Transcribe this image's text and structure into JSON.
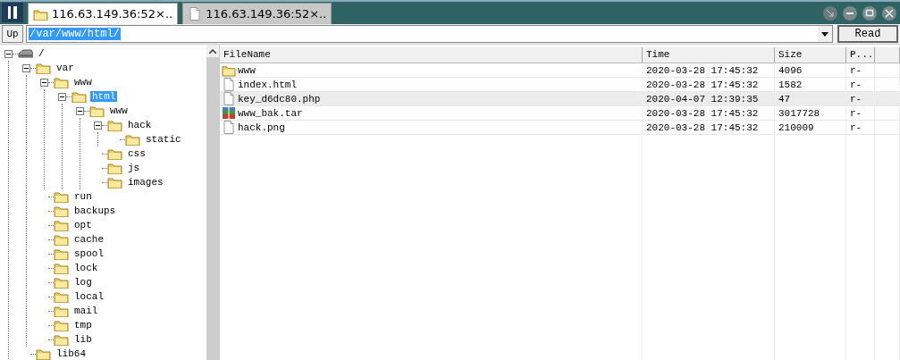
{
  "tabs": [
    {
      "label": "116.63.149.36:52×..",
      "kind": "folder",
      "selected": true
    },
    {
      "label": "116.63.149.36:52×..",
      "kind": "file",
      "selected": false
    }
  ],
  "address": {
    "button": "Up",
    "value": "/var/www/html/",
    "action": "Read"
  },
  "tree": [
    {
      "label": "/",
      "kind": "drive",
      "expanded": true,
      "selected": false,
      "children": [
        {
          "label": "var",
          "kind": "folder",
          "expanded": true,
          "selected": false,
          "children": [
            {
              "label": "www",
              "kind": "folder",
              "expanded": true,
              "selected": false,
              "children": [
                {
                  "label": "html",
                  "kind": "folder",
                  "expanded": true,
                  "selected": true,
                  "children": [
                    {
                      "label": "www",
                      "kind": "folder",
                      "expanded": true,
                      "selected": false,
                      "children": [
                        {
                          "label": "hack",
                          "kind": "folder",
                          "expanded": true,
                          "selected": false,
                          "children": [
                            {
                              "label": "static",
                              "kind": "folder",
                              "selected": false
                            }
                          ]
                        },
                        {
                          "label": "css",
                          "kind": "folder",
                          "selected": false
                        },
                        {
                          "label": "js",
                          "kind": "folder",
                          "selected": false
                        },
                        {
                          "label": "images",
                          "kind": "folder",
                          "selected": false
                        }
                      ]
                    }
                  ]
                }
              ]
            },
            {
              "label": "run",
              "kind": "folder",
              "selected": false
            },
            {
              "label": "backups",
              "kind": "folder",
              "selected": false
            },
            {
              "label": "opt",
              "kind": "folder",
              "selected": false
            },
            {
              "label": "cache",
              "kind": "folder",
              "selected": false
            },
            {
              "label": "spool",
              "kind": "folder",
              "selected": false
            },
            {
              "label": "lock",
              "kind": "folder",
              "selected": false
            },
            {
              "label": "log",
              "kind": "folder",
              "selected": false
            },
            {
              "label": "local",
              "kind": "folder",
              "selected": false
            },
            {
              "label": "mail",
              "kind": "folder",
              "selected": false
            },
            {
              "label": "tmp",
              "kind": "folder",
              "selected": false
            },
            {
              "label": "lib",
              "kind": "folder",
              "selected": false
            }
          ]
        },
        {
          "label": "lib64",
          "kind": "folder",
          "selected": false
        }
      ]
    }
  ],
  "table": {
    "columns": [
      "FileName",
      "Time",
      "Size",
      "P..."
    ],
    "rows": [
      {
        "kind": "folder",
        "name": "www",
        "time": "2020-03-28 17:45:32",
        "size": "4096",
        "perm": "r-",
        "selected": false
      },
      {
        "kind": "file",
        "name": "index.html",
        "time": "2020-03-28 17:45:32",
        "size": "1582",
        "perm": "r-",
        "selected": false
      },
      {
        "kind": "file",
        "name": "key_d6dc80.php",
        "time": "2020-04-07 12:39:35",
        "size": "47",
        "perm": "r-",
        "selected": true
      },
      {
        "kind": "archive",
        "name": "www_bak.tar",
        "time": "2020-03-28 17:45:32",
        "size": "3017728",
        "perm": "r-",
        "selected": false
      },
      {
        "kind": "file",
        "name": "hack.png",
        "time": "2020-03-28 17:45:32",
        "size": "210009",
        "perm": "r-",
        "selected": false
      }
    ]
  }
}
